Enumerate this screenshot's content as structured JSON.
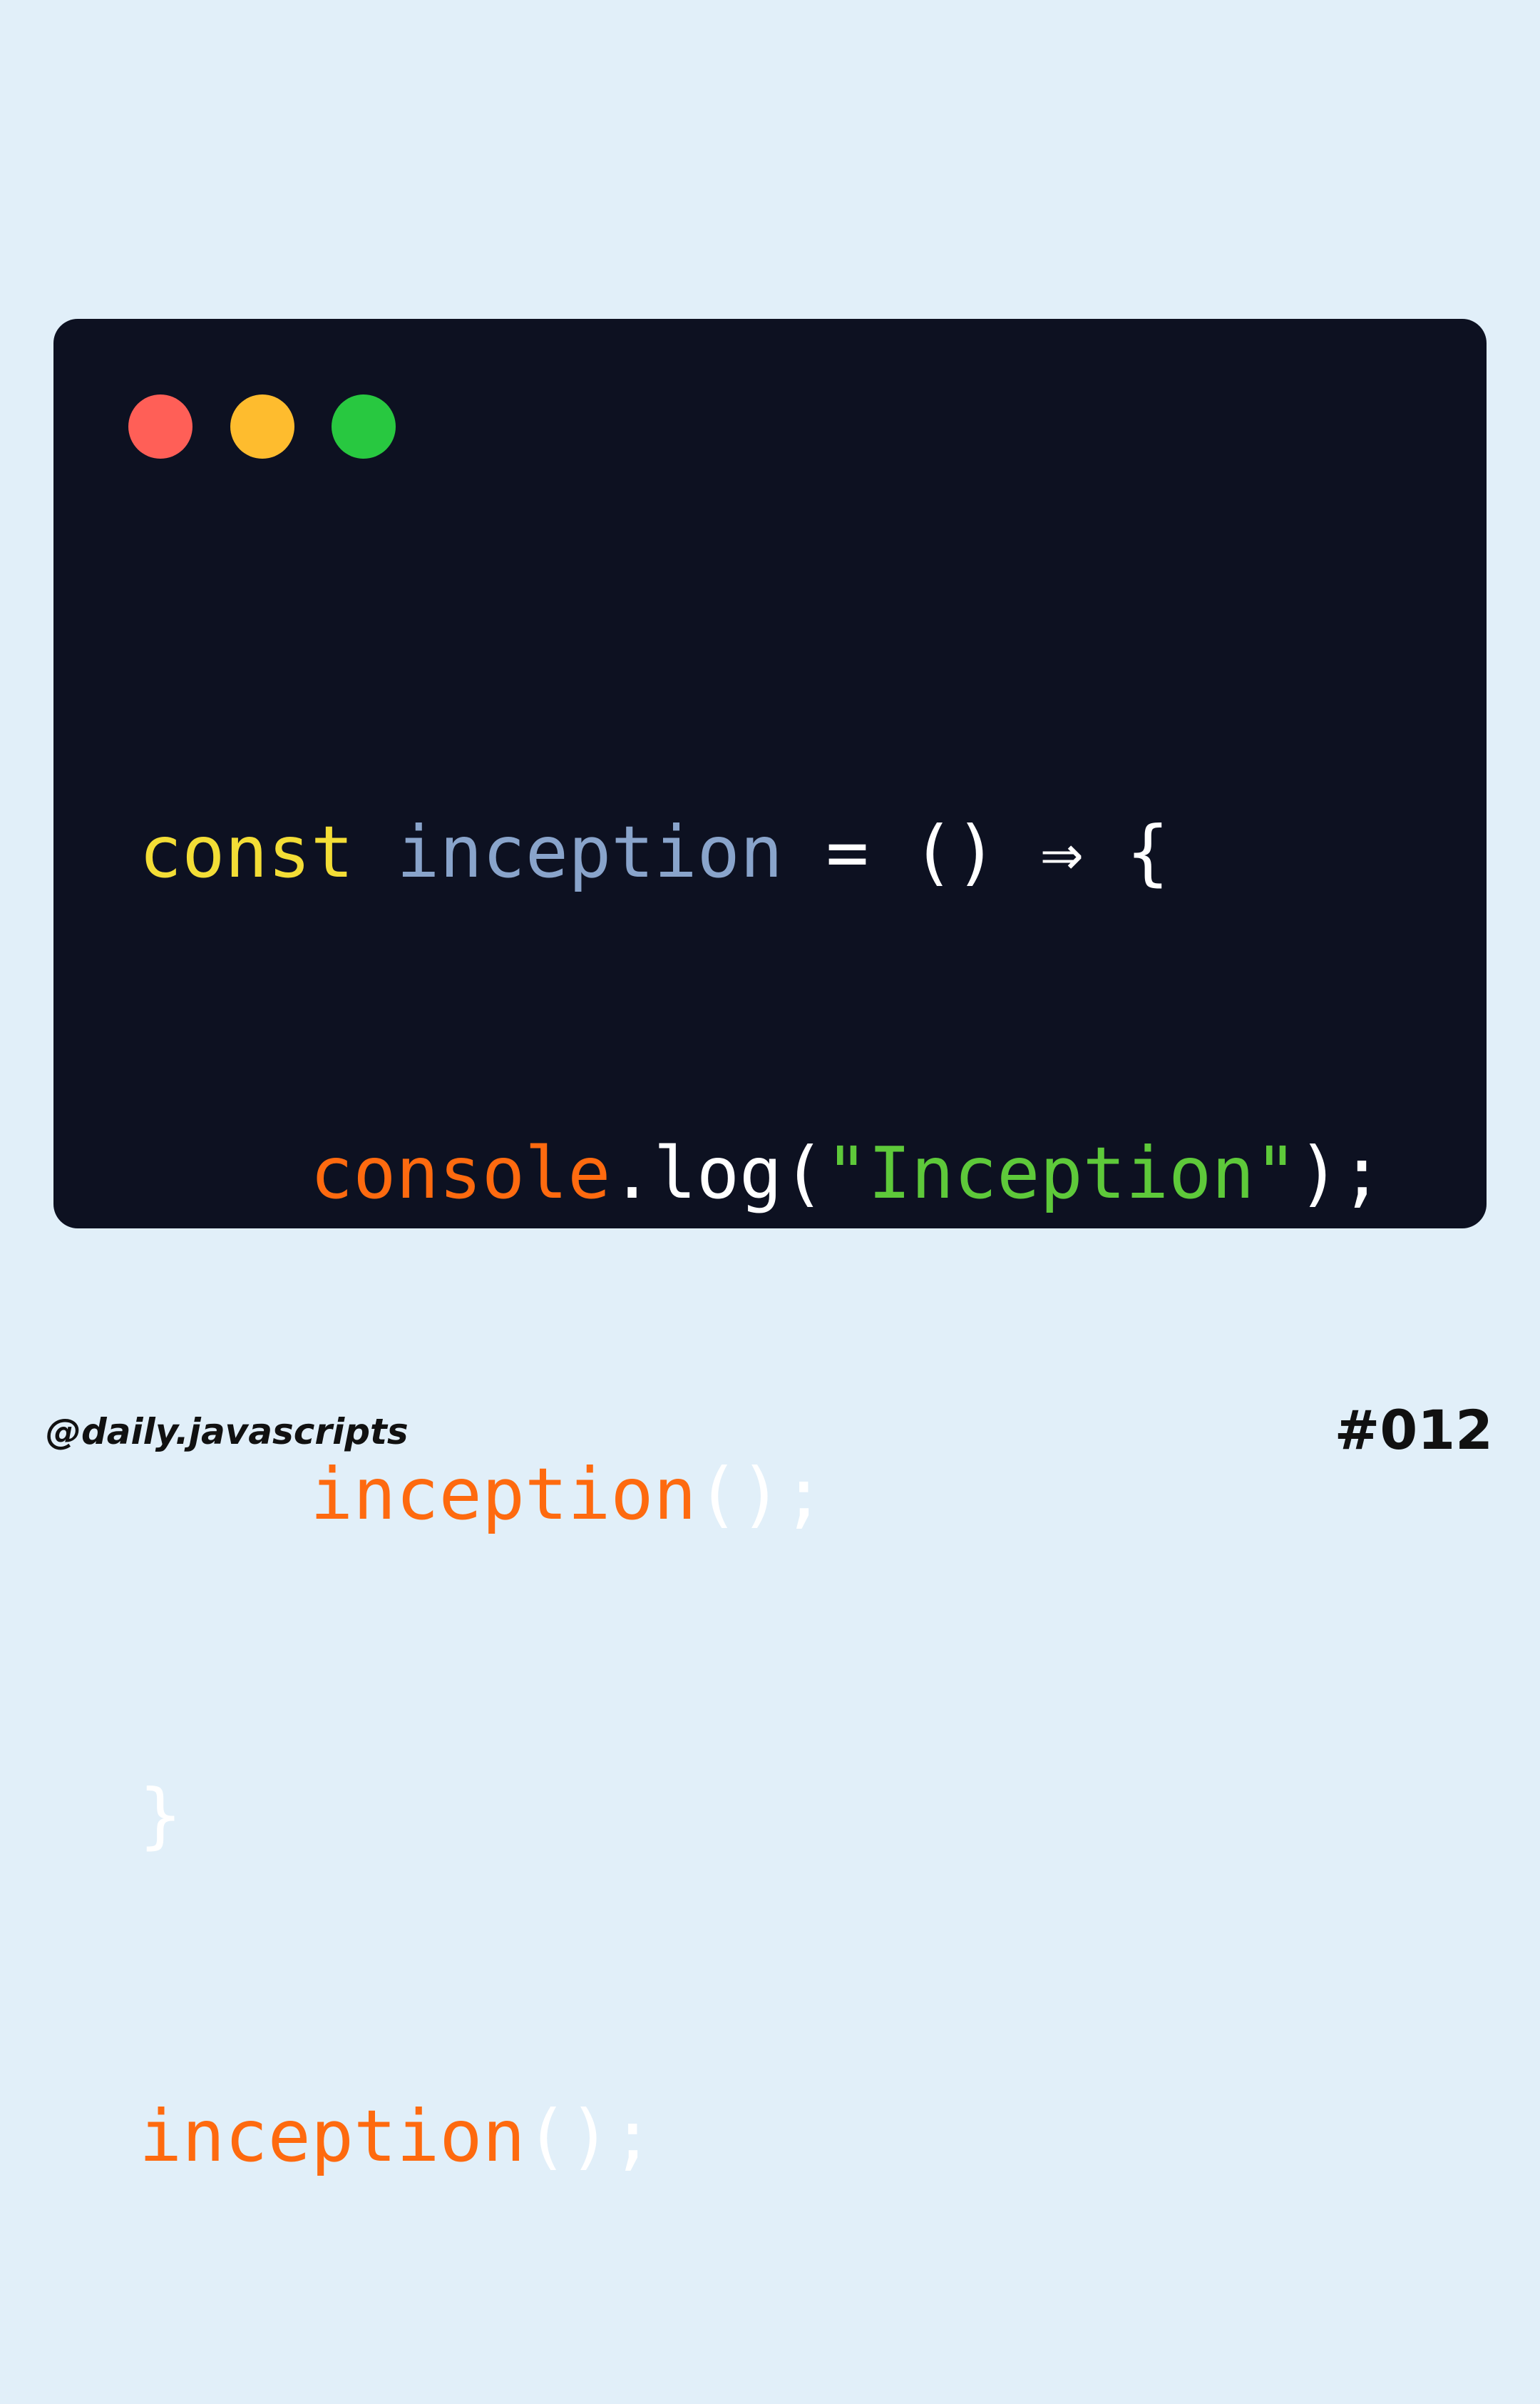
{
  "window": {
    "controls": [
      "close",
      "minimize",
      "maximize"
    ],
    "colors": {
      "background": "#0d1121",
      "close": "#ff5f57",
      "minimize": "#febc2e",
      "maximize": "#28c840"
    }
  },
  "code": {
    "line1": {
      "keyword": "const",
      "name": "inception",
      "rest": "= () ⇒ {"
    },
    "line2": {
      "object": "console",
      "method": ".log(",
      "string": "\"Inception\"",
      "close": ");"
    },
    "line3": {
      "call": "inception",
      "close": "();"
    },
    "line4": {
      "brace": "}"
    },
    "line5": {
      "call": "inception",
      "close": "();"
    }
  },
  "colors": {
    "page_background": "#e1eff9",
    "keyword": "#f3dd36",
    "variable": "#89a4cb",
    "function": "#fe6a0f",
    "string": "#5ec93a",
    "punctuation": "#ffffff"
  },
  "footer": {
    "handle": "@daily.javascripts",
    "post_number": "#012"
  }
}
